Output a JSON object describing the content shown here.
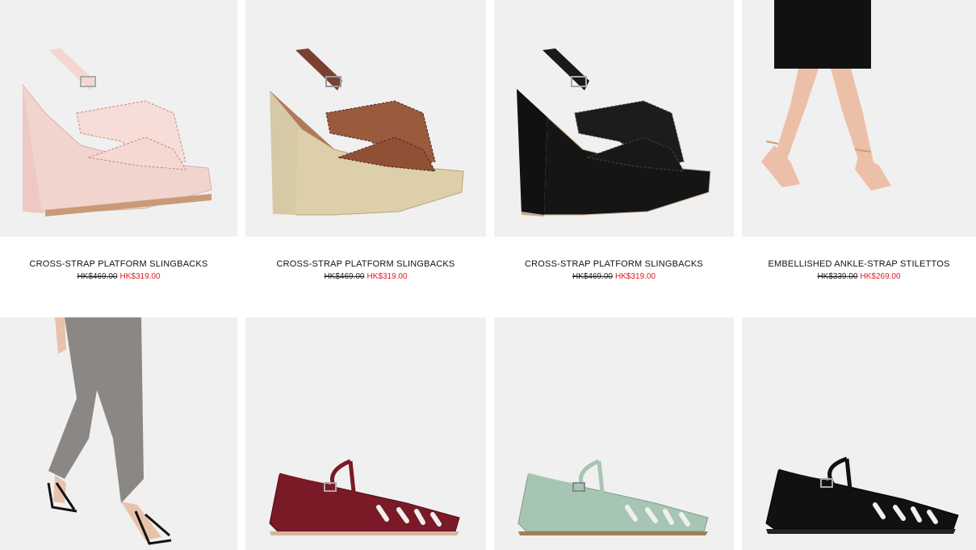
{
  "products": [
    {
      "name": "CROSS-STRAP PLATFORM SLINGBACKS",
      "old_price": "HK$469.00",
      "sale_price": "HK$319.00",
      "image": "blush-pink-platform-sandal"
    },
    {
      "name": "CROSS-STRAP PLATFORM SLINGBACKS",
      "old_price": "HK$469.00",
      "sale_price": "HK$319.00",
      "image": "brown-platform-sandal"
    },
    {
      "name": "CROSS-STRAP PLATFORM SLINGBACKS",
      "old_price": "HK$469.00",
      "sale_price": "HK$319.00",
      "image": "black-platform-sandal"
    },
    {
      "name": "EMBELLISHED ANKLE-STRAP STILETTOS",
      "old_price": "HK$339.00",
      "sale_price": "HK$269.00",
      "image": "model-wearing-clear-stilettos"
    },
    {
      "image": "model-wearing-black-ankle-strap-heels"
    },
    {
      "image": "burgundy-caged-flat"
    },
    {
      "image": "sage-green-caged-flat"
    },
    {
      "image": "black-caged-flat"
    }
  ],
  "colors": {
    "sale": "#e0191f",
    "image_bg": "#f0f0f0",
    "text": "#111111"
  }
}
